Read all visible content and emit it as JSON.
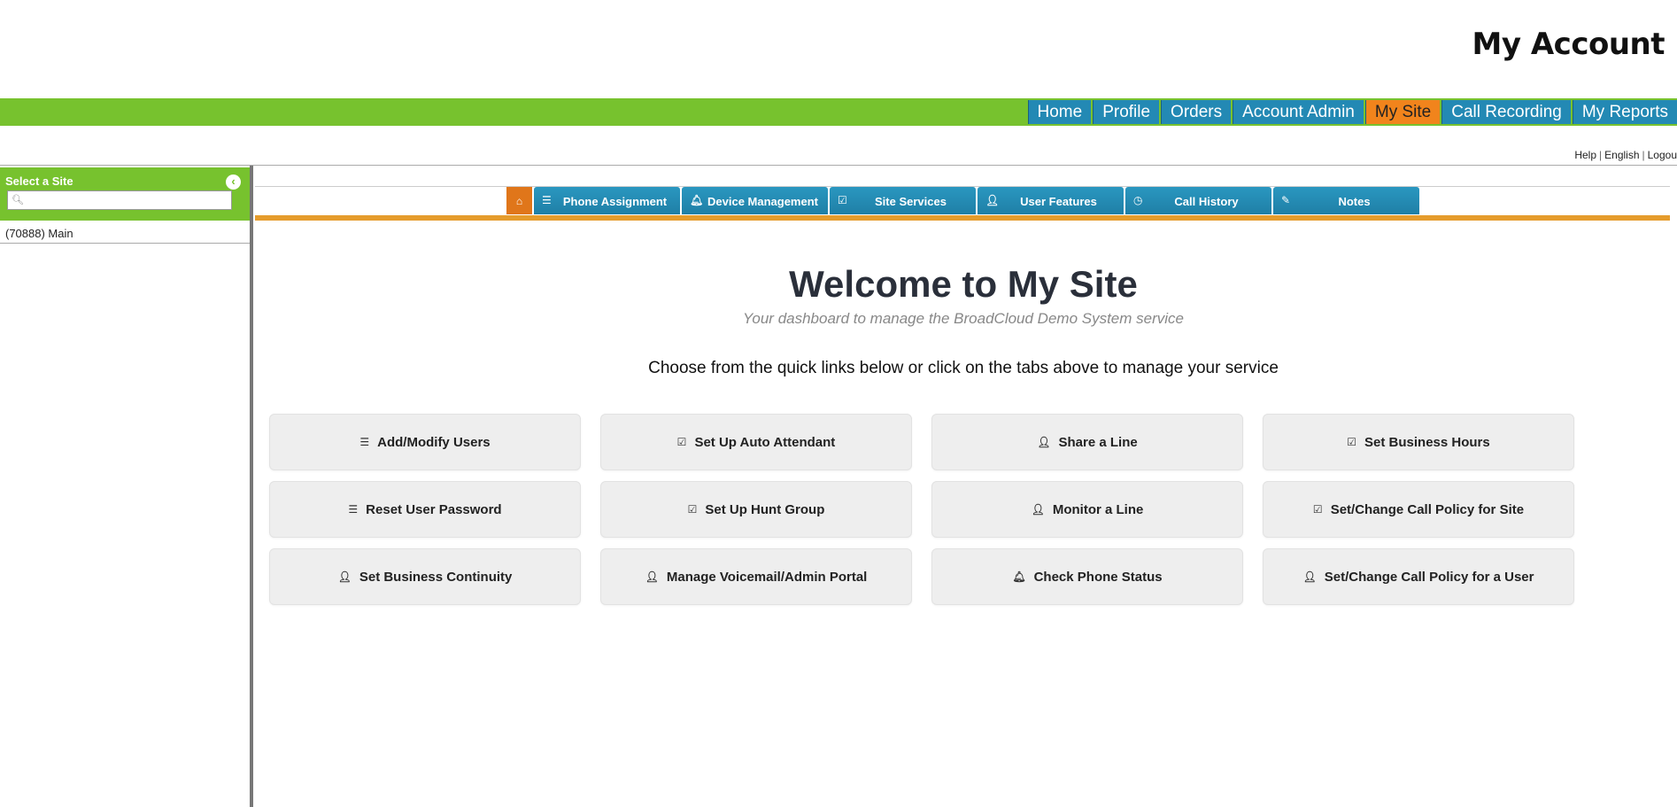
{
  "header": {
    "title": "My Account"
  },
  "mainnav": {
    "items": [
      {
        "label": "Home"
      },
      {
        "label": "Profile"
      },
      {
        "label": "Orders"
      },
      {
        "label": "Account Admin"
      },
      {
        "label": "My Site",
        "active": true
      },
      {
        "label": "Call Recording"
      },
      {
        "label": "My Reports"
      }
    ]
  },
  "utility": {
    "help": "Help",
    "language": "English",
    "logout": "Logou"
  },
  "sidebar": {
    "title": "Select a Site",
    "search_placeholder": "",
    "sites": [
      {
        "label": "(70888) Main"
      }
    ]
  },
  "tabs": [
    {
      "label": "Phone Assignment",
      "icon": "list-icon"
    },
    {
      "label": "Device Management",
      "icon": "bell-icon"
    },
    {
      "label": "Site Services",
      "icon": "check-edit-icon"
    },
    {
      "label": "User Features",
      "icon": "user-icon"
    },
    {
      "label": "Call History",
      "icon": "clock-icon"
    },
    {
      "label": "Notes",
      "icon": "pencil-icon"
    }
  ],
  "main": {
    "welcome": "Welcome to My Site",
    "subtitle": "Your dashboard to manage the BroadCloud Demo System service",
    "instruction": "Choose from the quick links below or click on the tabs above to manage your service"
  },
  "quick_links": [
    {
      "label": "Add/Modify Users",
      "icon": "list-icon"
    },
    {
      "label": "Set Up Auto Attendant",
      "icon": "check-edit-icon"
    },
    {
      "label": "Share a Line",
      "icon": "user-icon"
    },
    {
      "label": "Set Business Hours",
      "icon": "check-edit-icon"
    },
    {
      "label": "Reset User Password",
      "icon": "list-icon"
    },
    {
      "label": "Set Up Hunt Group",
      "icon": "check-edit-icon"
    },
    {
      "label": "Monitor a Line",
      "icon": "user-icon"
    },
    {
      "label": "Set/Change Call Policy for Site",
      "icon": "check-edit-icon"
    },
    {
      "label": "Set Business Continuity",
      "icon": "user-icon"
    },
    {
      "label": "Manage Voicemail/Admin Portal",
      "icon": "user-icon"
    },
    {
      "label": "Check Phone Status",
      "icon": "bell-icon"
    },
    {
      "label": "Set/Change Call Policy for a User",
      "icon": "user-icon"
    }
  ],
  "colors": {
    "green": "#77c22e",
    "blue": "#2389b4",
    "orange": "#f1841c",
    "bar_orange": "#e59c2c"
  }
}
